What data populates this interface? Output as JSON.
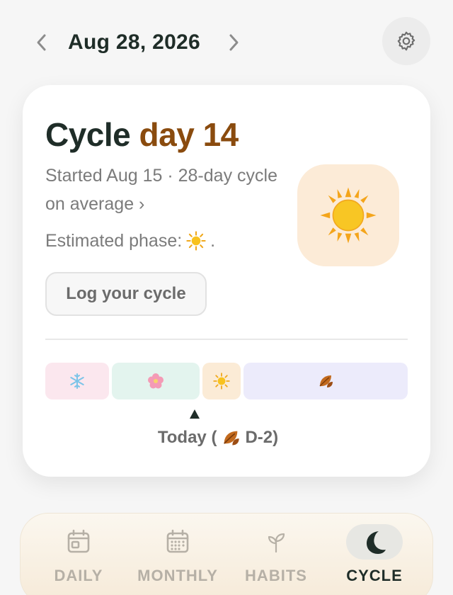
{
  "header": {
    "date": "Aug 28, 2026",
    "prev_icon": "chevron-left-icon",
    "next_icon": "chevron-right-icon",
    "settings_icon": "gear-icon"
  },
  "card": {
    "title_word": "Cycle",
    "title_day": "day 14",
    "started_text": "Started Aug 15 · 28-day cycle on average ›",
    "phase_prefix": "Estimated phase:",
    "phase_suffix": ".",
    "phase_icon": "sun-icon",
    "log_button": "Log your cycle",
    "accent_color": "#8a4b0e"
  },
  "timeline": {
    "segments": [
      {
        "phase": "winter",
        "icon": "snowflake-icon",
        "color": "#fbe7ee"
      },
      {
        "phase": "spring",
        "icon": "flower-icon",
        "color": "#e3f4ee"
      },
      {
        "phase": "summer",
        "icon": "sun-icon",
        "color": "#fbebd6"
      },
      {
        "phase": "autumn",
        "icon": "leaf-icon",
        "color": "#ecebfb"
      }
    ],
    "today_prefix": "Today (",
    "today_suffix": "D-2)"
  },
  "tabs": [
    {
      "label": "DAILY",
      "icon": "calendar-day-icon",
      "active": false
    },
    {
      "label": "MONTHLY",
      "icon": "calendar-month-icon",
      "active": false
    },
    {
      "label": "HABITS",
      "icon": "sprout-icon",
      "active": false
    },
    {
      "label": "CYCLE",
      "icon": "moon-icon",
      "active": true
    }
  ]
}
